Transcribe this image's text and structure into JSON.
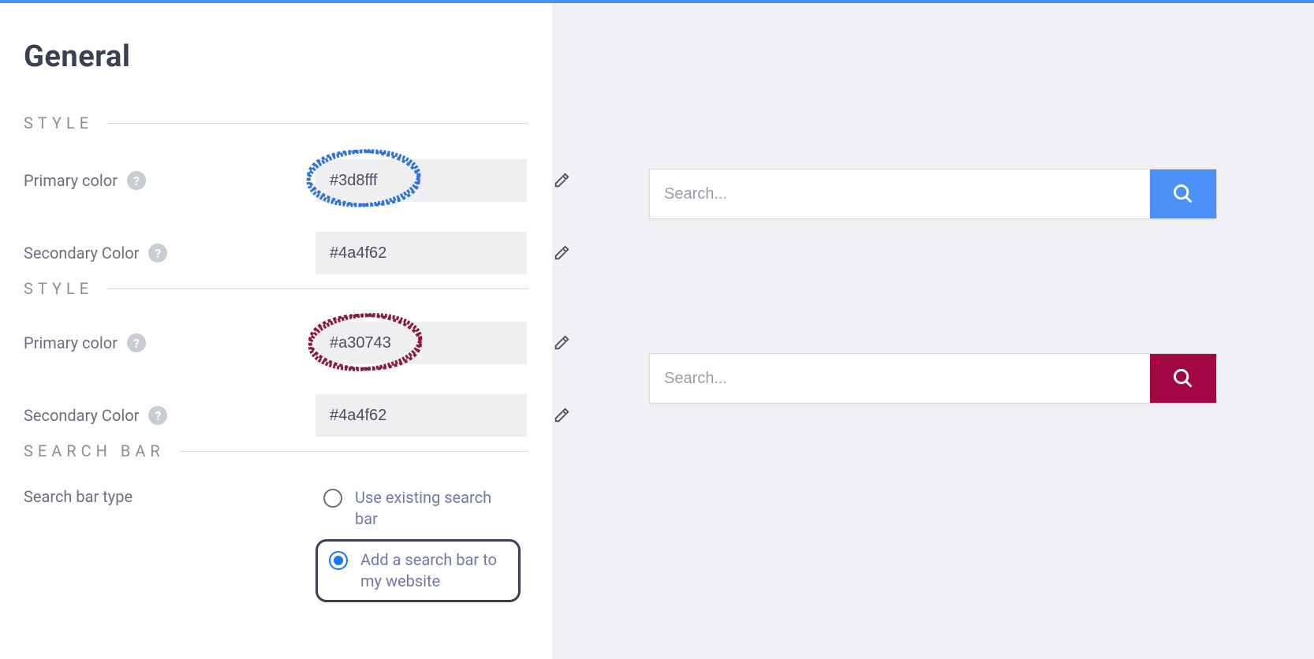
{
  "page": {
    "title": "General"
  },
  "sections": {
    "style1": {
      "heading": "STYLE",
      "primary_label": "Primary color",
      "primary_value": "#3d8fff",
      "secondary_label": "Secondary Color",
      "secondary_value": "#4a4f62"
    },
    "style2": {
      "heading": "STYLE",
      "primary_label": "Primary color",
      "primary_value": "#a30743",
      "secondary_label": "Secondary Color",
      "secondary_value": "#4a4f62"
    },
    "searchbar": {
      "heading": "SEARCH BAR",
      "type_label": "Search bar type",
      "opt_existing": "Use existing search bar",
      "opt_add": "Add a search bar to my website",
      "selected": "add"
    }
  },
  "preview": {
    "placeholder": "Search...",
    "btn1_color": "#4a90f7",
    "btn2_color": "#a30743"
  },
  "annotations": {
    "circle1_color": "#2f72d9",
    "circle2_color": "#8a1a3f"
  }
}
